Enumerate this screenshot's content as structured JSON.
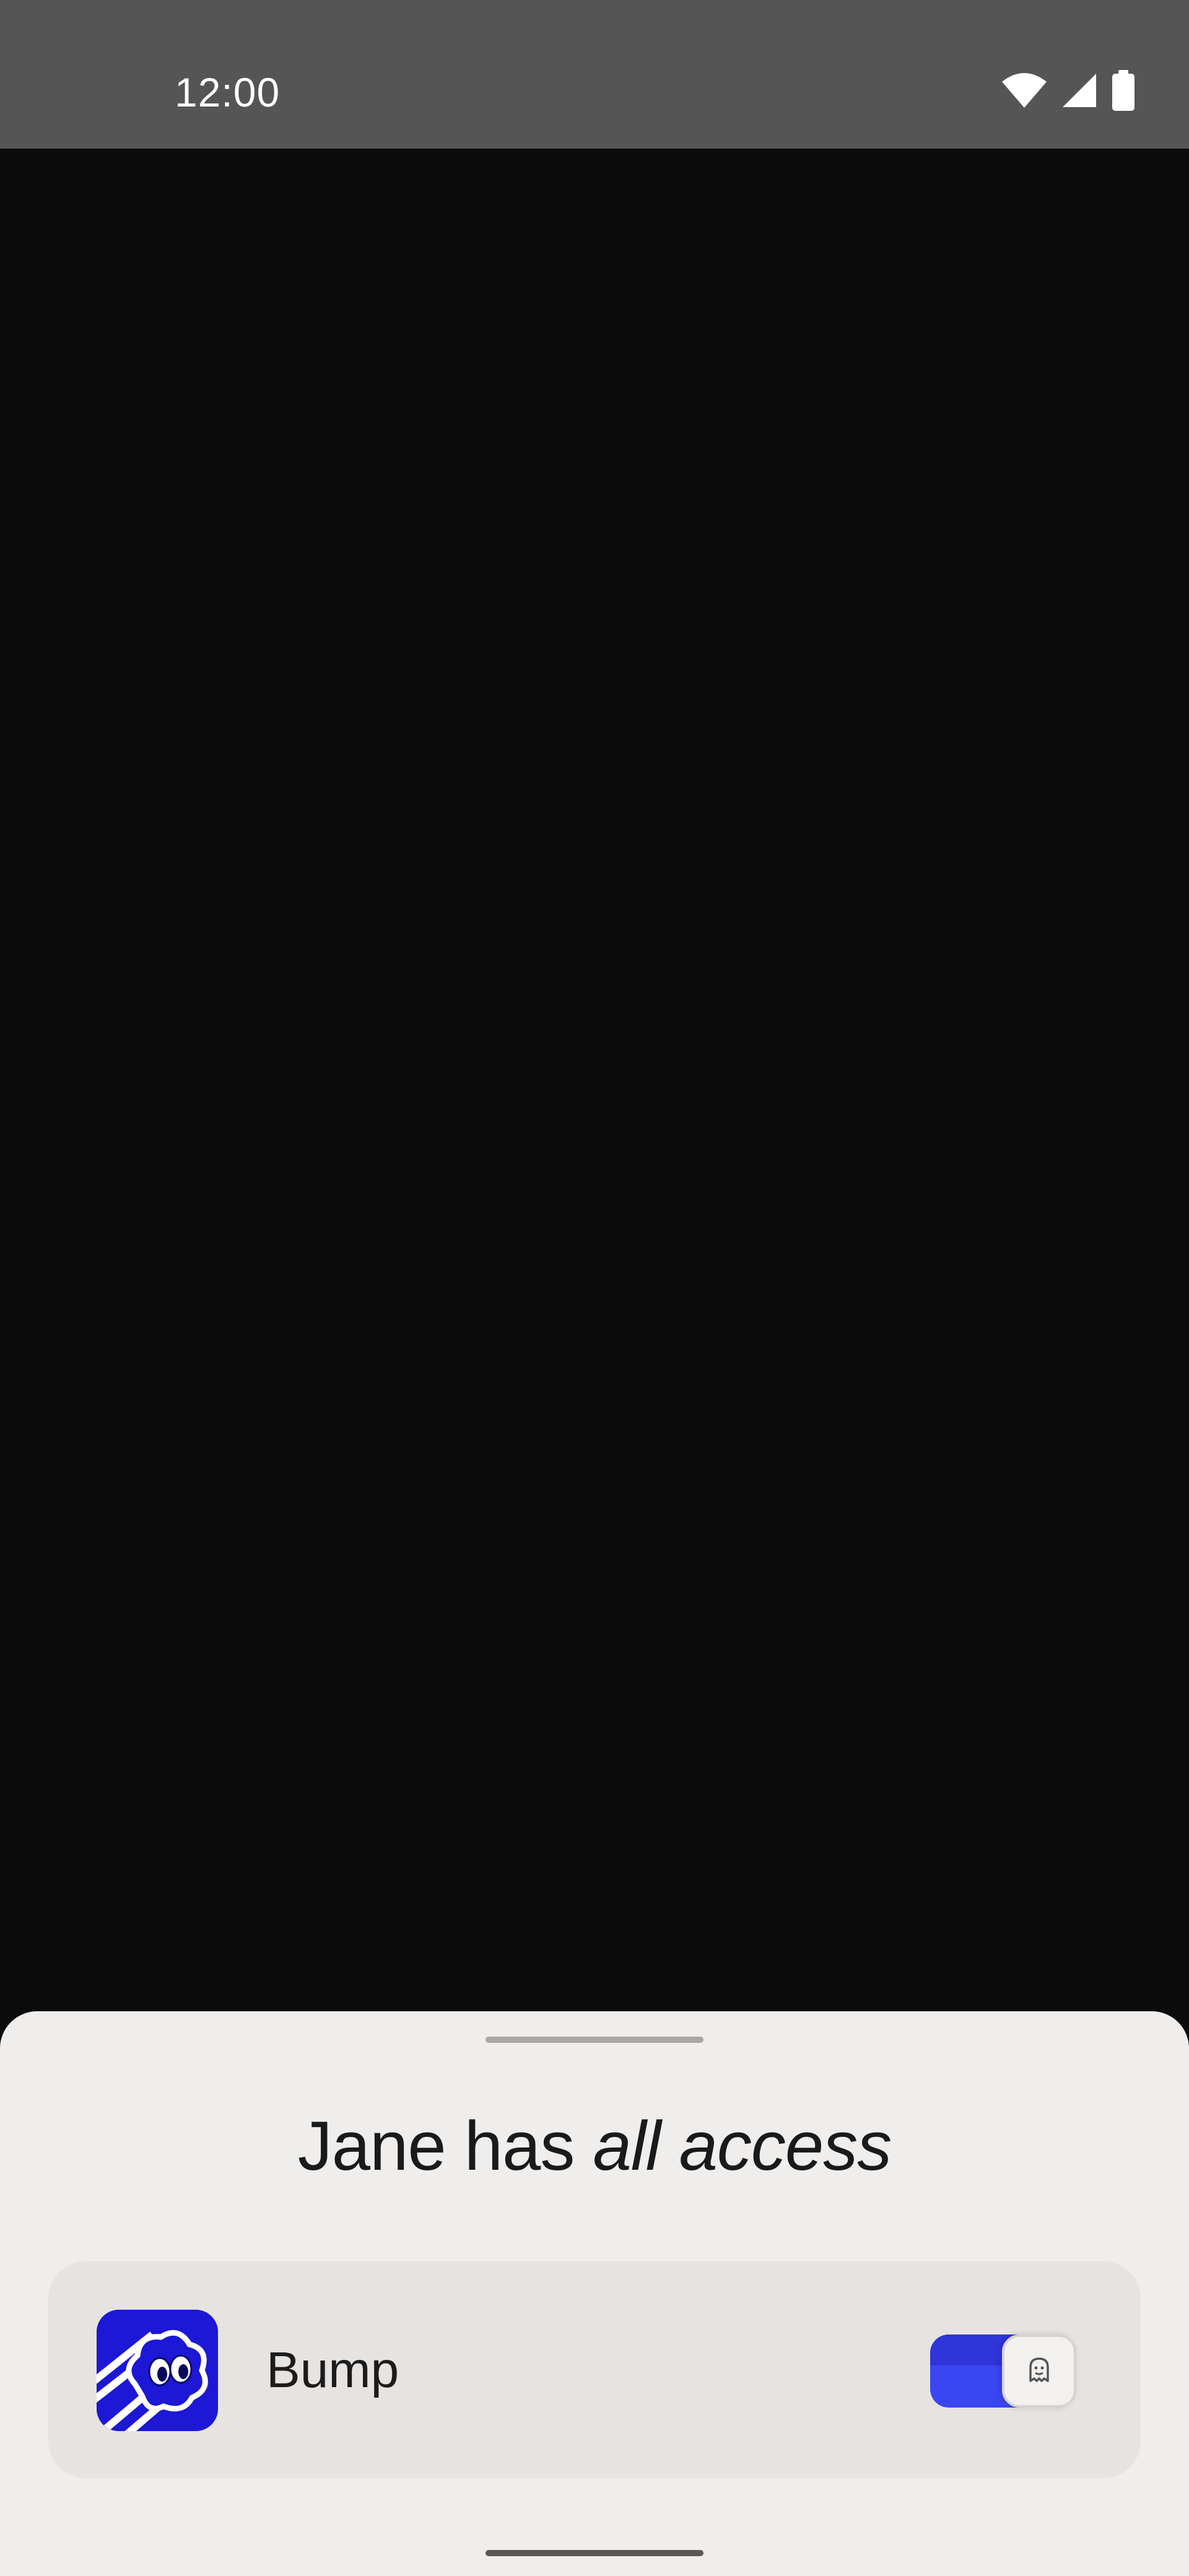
{
  "status_bar": {
    "time": "12:00",
    "icons": [
      "wifi-icon",
      "cellular-signal-icon",
      "battery-icon"
    ]
  },
  "bottom_sheet": {
    "title_prefix": "Jane has ",
    "title_emphasis": "all access",
    "app": {
      "name": "Bump",
      "icon": "bump-app-icon",
      "toggle_state": "on"
    }
  },
  "colors": {
    "status_bar_bg": "#555555",
    "content_bg": "#0b0b0b",
    "sheet_bg": "#f0eeec",
    "card_bg": "#e6e3e1",
    "accent_blue": "#3a46f2",
    "app_icon_bg": "#1d17d6"
  }
}
